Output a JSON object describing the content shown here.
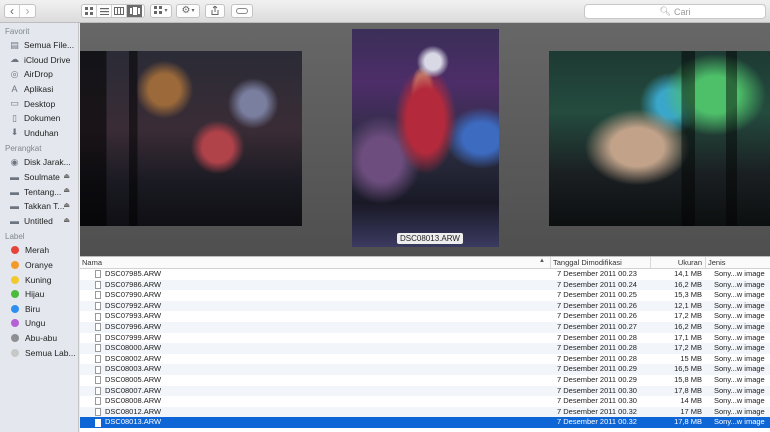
{
  "toolbar": {
    "search_placeholder": "Cari",
    "back_icon": "‹",
    "forward_icon": "›"
  },
  "sidebar": {
    "favorites_title": "Favorit",
    "favorites": [
      {
        "label": "Semua File...",
        "icon": "all-files-icon"
      },
      {
        "label": "iCloud Drive",
        "icon": "cloud-icon"
      },
      {
        "label": "AirDrop",
        "icon": "airdrop-icon"
      },
      {
        "label": "Aplikasi",
        "icon": "applications-icon"
      },
      {
        "label": "Desktop",
        "icon": "desktop-icon"
      },
      {
        "label": "Dokumen",
        "icon": "documents-icon"
      },
      {
        "label": "Unduhan",
        "icon": "downloads-icon"
      }
    ],
    "devices_title": "Perangkat",
    "devices": [
      {
        "label": "Disk Jarak...",
        "icon": "disk-icon"
      },
      {
        "label": "Soulmate",
        "icon": "drive-icon"
      },
      {
        "label": "Tentang...",
        "icon": "drive-icon"
      },
      {
        "label": "Takkan T...",
        "icon": "drive-icon"
      },
      {
        "label": "Untitled",
        "icon": "drive-icon"
      }
    ],
    "tags_title": "Label",
    "tags": [
      {
        "label": "Merah",
        "color": "#e8433b"
      },
      {
        "label": "Oranye",
        "color": "#f39a2b"
      },
      {
        "label": "Kuning",
        "color": "#f1c92c"
      },
      {
        "label": "Hijau",
        "color": "#4bbb3a"
      },
      {
        "label": "Biru",
        "color": "#2e8ff0"
      },
      {
        "label": "Ungu",
        "color": "#b562d6"
      },
      {
        "label": "Abu-abu",
        "color": "#8e8e93"
      },
      {
        "label": "Semua Lab...",
        "color": "#c8c8c8"
      }
    ]
  },
  "coverflow": {
    "selected_caption": "DSC08013.ARW"
  },
  "list": {
    "columns": {
      "name": "Nama",
      "date": "Tanggal Dimodifikasi",
      "size": "Ukuran",
      "kind": "Jenis"
    },
    "rows": [
      {
        "name": "DSC07985.ARW",
        "date": "7 Desember 2011 00.23",
        "size": "14,1 MB",
        "kind": "Sony...w image"
      },
      {
        "name": "DSC07986.ARW",
        "date": "7 Desember 2011 00.24",
        "size": "16,2 MB",
        "kind": "Sony...w image"
      },
      {
        "name": "DSC07990.ARW",
        "date": "7 Desember 2011 00.25",
        "size": "15,3 MB",
        "kind": "Sony...w image"
      },
      {
        "name": "DSC07992.ARW",
        "date": "7 Desember 2011 00.26",
        "size": "12,1 MB",
        "kind": "Sony...w image"
      },
      {
        "name": "DSC07993.ARW",
        "date": "7 Desember 2011 00.26",
        "size": "17,2 MB",
        "kind": "Sony...w image"
      },
      {
        "name": "DSC07996.ARW",
        "date": "7 Desember 2011 00.27",
        "size": "16,2 MB",
        "kind": "Sony...w image"
      },
      {
        "name": "DSC07999.ARW",
        "date": "7 Desember 2011 00.28",
        "size": "17,1 MB",
        "kind": "Sony...w image"
      },
      {
        "name": "DSC08000.ARW",
        "date": "7 Desember 2011 00.28",
        "size": "17,2 MB",
        "kind": "Sony...w image"
      },
      {
        "name": "DSC08002.ARW",
        "date": "7 Desember 2011 00.28",
        "size": "15 MB",
        "kind": "Sony...w image"
      },
      {
        "name": "DSC08003.ARW",
        "date": "7 Desember 2011 00.29",
        "size": "16,5 MB",
        "kind": "Sony...w image"
      },
      {
        "name": "DSC08005.ARW",
        "date": "7 Desember 2011 00.29",
        "size": "15,8 MB",
        "kind": "Sony...w image"
      },
      {
        "name": "DSC08007.ARW",
        "date": "7 Desember 2011 00.30",
        "size": "17,8 MB",
        "kind": "Sony...w image"
      },
      {
        "name": "DSC08008.ARW",
        "date": "7 Desember 2011 00.30",
        "size": "14 MB",
        "kind": "Sony...w image"
      },
      {
        "name": "DSC08012.ARW",
        "date": "7 Desember 2011 00.32",
        "size": "17 MB",
        "kind": "Sony...w image"
      },
      {
        "name": "DSC08013.ARW",
        "date": "7 Desember 2011 00.32",
        "size": "17,8 MB",
        "kind": "Sony...w image",
        "selected": true
      }
    ]
  }
}
